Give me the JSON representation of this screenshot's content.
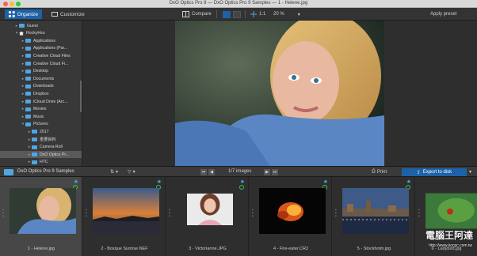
{
  "window": {
    "title": "DxO Optics Pro 9 — DxO Optics Pro 9 Samples — 1 - Helene.jpg"
  },
  "toolbar": {
    "organize": "Organize",
    "customize": "Customize",
    "compare": "Compare",
    "fit": "1:1",
    "zoom": "20 %",
    "apply_preset": "Apply preset"
  },
  "tree": [
    {
      "label": "Guest",
      "type": "folder"
    },
    {
      "label": "RockyHsu",
      "type": "home"
    },
    {
      "label": "Applications",
      "type": "folder"
    },
    {
      "label": "Applications (Par...",
      "type": "folder"
    },
    {
      "label": "Creative Cloud Files",
      "type": "folder"
    },
    {
      "label": "Creative Cloud Fi...",
      "type": "folder"
    },
    {
      "label": "Desktop",
      "type": "folder"
    },
    {
      "label": "Documents",
      "type": "folder"
    },
    {
      "label": "Downloads",
      "type": "folder"
    },
    {
      "label": "Dropbox",
      "type": "folder"
    },
    {
      "label": "iCloud Drive (Arc...",
      "type": "folder"
    },
    {
      "label": "Movies",
      "type": "folder"
    },
    {
      "label": "Music",
      "type": "folder"
    },
    {
      "label": "Pictures",
      "type": "folder"
    },
    {
      "label": "2017",
      "type": "folder"
    },
    {
      "label": "重要資料",
      "type": "folder"
    },
    {
      "label": "Camera Roll",
      "type": "folder"
    },
    {
      "label": "DxO Optics Pr...",
      "type": "folder"
    },
    {
      "label": "HTC",
      "type": "folder"
    }
  ],
  "filmbar": {
    "folder_title": "DxO Optics Pro 9 Samples",
    "count": "1/7 images",
    "print": "Print",
    "export": "Export to disk"
  },
  "thumbnails": [
    {
      "label": "1 - Helene.jpg"
    },
    {
      "label": "2 - Bosque Sunrise.NEF"
    },
    {
      "label": "3 - Victorianne.JPG"
    },
    {
      "label": "4 - Fire-eater.CR2"
    },
    {
      "label": "5 - Stockholm.jpg"
    },
    {
      "label": "6 - Ladybird.jpg"
    }
  ],
  "watermark": {
    "text": "電腦王阿達",
    "url": "http://www.kocpc.com.tw"
  },
  "colors": {
    "accent": "#1d62a8",
    "folder": "#4ea7e3",
    "ok": "#2ecc40"
  }
}
